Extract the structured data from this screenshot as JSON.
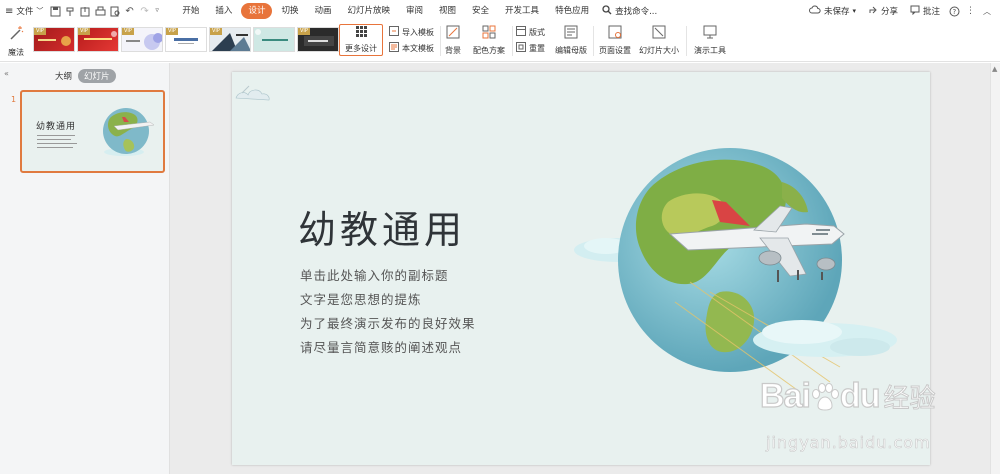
{
  "menu": {
    "file_label": "文件",
    "tabs": [
      "开始",
      "插入",
      "设计",
      "切换",
      "动画",
      "幻灯片放映",
      "审阅",
      "视图",
      "安全",
      "开发工具",
      "特色应用"
    ],
    "active_tab": "设计",
    "search_placeholder": "查找命令...",
    "unsaved_label": "未保存",
    "share_label": "分享",
    "comment_label": "批注"
  },
  "ribbon": {
    "magic_label": "魔法",
    "more_designs_label": "更多设计",
    "vip_badge": "VIP",
    "import_template_label": "导入模板",
    "text_template_label": "本文模板",
    "background_label": "背景",
    "color_scheme_label": "配色方案",
    "layout_label": "版式",
    "reset_label": "重置",
    "edit_master_label": "编辑母版",
    "page_setup_label": "页面设置",
    "slide_size_label": "幻灯片大小",
    "presenter_tools_label": "演示工具"
  },
  "left_panel": {
    "outline_tab": "大纲",
    "slides_tab": "幻灯片",
    "slide_number": "1",
    "thumb_title": "幼教通用"
  },
  "slide": {
    "title": "幼教通用",
    "subtitles": [
      "单击此处输入你的副标题",
      "文字是您思想的提炼",
      "为了最终演示发布的良好效果",
      "请尽量言简意赅的阐述观点"
    ]
  },
  "watermark": {
    "brand": "Bai",
    "brand2": "du",
    "suffix": "经验",
    "url": "jingyan.baidu.com"
  },
  "colors": {
    "accent": "#e8743b",
    "slide_bg": "#e8f1ef",
    "canvas_bg": "#ebebeb"
  }
}
